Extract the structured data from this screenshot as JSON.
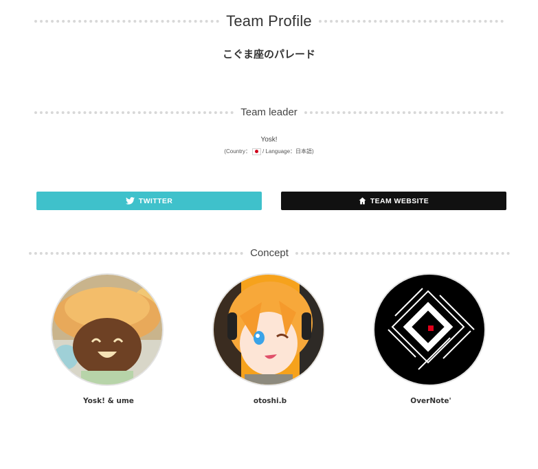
{
  "sections": {
    "profile_heading": "Team Profile",
    "leader_heading": "Team leader",
    "concept_heading": "Concept"
  },
  "team": {
    "name": "こぐま座のパレード"
  },
  "leader": {
    "name": "Yosk!",
    "country_prefix": "(Country：",
    "country_flag_icon": "japan-flag-icon",
    "language_part": "/ Language：日本語)"
  },
  "buttons": {
    "twitter_label": "TWITTER",
    "twitter_icon": "twitter-bird-icon",
    "website_label": "TEAM WEBSITE",
    "website_icon": "home-icon"
  },
  "members": [
    {
      "name": "Yosk! & ume",
      "avatar": "avatar-illustration-hat-character"
    },
    {
      "name": "otoshi.b",
      "avatar": "avatar-illustration-orange-hair-girl"
    },
    {
      "name": "OverNote'",
      "avatar": "avatar-logo-overnote"
    }
  ],
  "colors": {
    "twitter_button": "#3fc1cb",
    "website_button": "#111111",
    "dots": "#d8d8d8",
    "text": "#333333"
  }
}
